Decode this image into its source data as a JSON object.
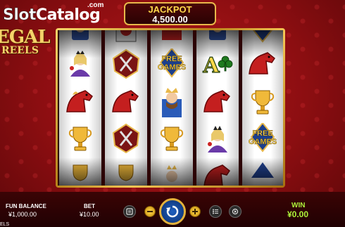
{
  "watermark": {
    "slot": "Slot",
    "catalog": "Catalog",
    "com": ".com"
  },
  "logo": {
    "line1": "EGAL",
    "line2": "REELS"
  },
  "jackpot": {
    "label": "JACKPOT",
    "value": "4,500.00"
  },
  "reels": [
    [
      "king",
      "queen",
      "horse",
      "trophy",
      "trophy"
    ],
    [
      "queen-card",
      "shield",
      "horse",
      "shield",
      "trophy"
    ],
    [
      "wild",
      "free-games",
      "king",
      "trophy",
      "queen"
    ],
    [
      "king",
      "ace",
      "horse",
      "queen",
      "horse"
    ],
    [
      "free-games",
      "horse",
      "trophy",
      "free-games",
      "ace"
    ]
  ],
  "symbol_text": {
    "free_games_1": "FREE",
    "free_games_2": "GAMES",
    "ace": "A"
  },
  "bottom": {
    "fun_balance_label": "FUN BALANCE",
    "fun_balance_value": "¥1,000.00",
    "bet_label": "BET",
    "bet_value": "¥10.00",
    "win_label": "WIN",
    "win_value": "¥0.00",
    "reels_footer": "ELS"
  },
  "colors": {
    "background": "#8e0f12",
    "gold": "#e8b84a",
    "win": "#aef53a",
    "jackpot_label": "#ffd84a"
  },
  "icons": [
    "paytable-icon",
    "minus-icon",
    "spin-icon",
    "plus-icon",
    "menu-icon",
    "autoplay-icon"
  ]
}
